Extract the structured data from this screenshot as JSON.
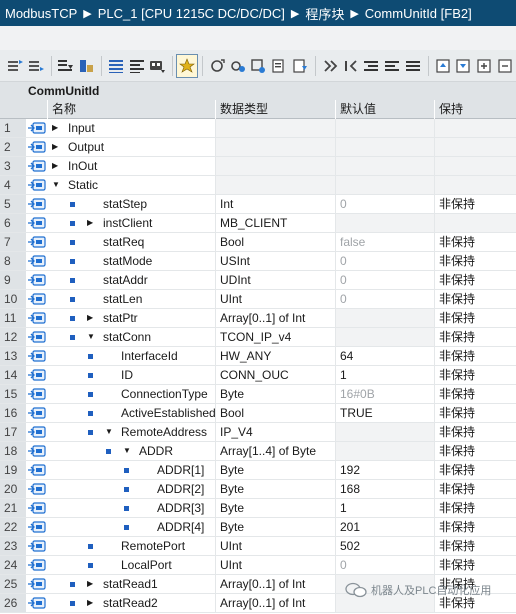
{
  "breadcrumb": [
    "ModbusTCP",
    "PLC_1 [CPU 1215C DC/DC/DC]",
    "程序块",
    "CommUnitId [FB2]"
  ],
  "block_name": "CommUnitId",
  "columns": {
    "name": "名称",
    "type": "数据类型",
    "default": "默认值",
    "retain": "保持"
  },
  "toolbar_icons": [
    "insert-row-icon",
    "add-row-icon",
    "expand-icon",
    "collapse-icon",
    "monitor-icon",
    "list-icon",
    "list-alt-icon",
    "snapshot-icon",
    "load-icon",
    "highlight-icon",
    "reset-icon",
    "go-icon",
    "watch-icon",
    "copy-values-icon",
    "paste-values-icon",
    "indent-icon",
    "outdent-icon",
    "align-icon",
    "move-up-icon",
    "move-down-icon",
    "expand-all-icon",
    "collapse-all-icon"
  ],
  "rows": [
    {
      "num": "1",
      "name": "Input",
      "type": "",
      "default": "",
      "retain": "",
      "depth": 0,
      "arrow": "right",
      "bullet": false,
      "default_gray": false
    },
    {
      "num": "2",
      "name": "Output",
      "type": "",
      "default": "",
      "retain": "",
      "depth": 0,
      "arrow": "right",
      "bullet": false,
      "default_gray": false
    },
    {
      "num": "3",
      "name": "InOut",
      "type": "",
      "default": "",
      "retain": "",
      "depth": 0,
      "arrow": "right",
      "bullet": false,
      "default_gray": false
    },
    {
      "num": "4",
      "name": "Static",
      "type": "",
      "default": "",
      "retain": "",
      "depth": 0,
      "arrow": "down",
      "bullet": false,
      "default_gray": false
    },
    {
      "num": "5",
      "name": "statStep",
      "type": "Int",
      "default": "0",
      "retain": "非保持",
      "depth": 1,
      "arrow": "",
      "bullet": true,
      "default_gray": true
    },
    {
      "num": "6",
      "name": "instClient",
      "type": "MB_CLIENT",
      "default": "",
      "retain": "",
      "depth": 1,
      "arrow": "right",
      "bullet": true,
      "default_gray": false
    },
    {
      "num": "7",
      "name": "statReq",
      "type": "Bool",
      "default": "false",
      "retain": "非保持",
      "depth": 1,
      "arrow": "",
      "bullet": true,
      "default_gray": true
    },
    {
      "num": "8",
      "name": "statMode",
      "type": "USInt",
      "default": "0",
      "retain": "非保持",
      "depth": 1,
      "arrow": "",
      "bullet": true,
      "default_gray": true
    },
    {
      "num": "9",
      "name": "statAddr",
      "type": "UDInt",
      "default": "0",
      "retain": "非保持",
      "depth": 1,
      "arrow": "",
      "bullet": true,
      "default_gray": true
    },
    {
      "num": "10",
      "name": "statLen",
      "type": "UInt",
      "default": "0",
      "retain": "非保持",
      "depth": 1,
      "arrow": "",
      "bullet": true,
      "default_gray": true
    },
    {
      "num": "11",
      "name": "statPtr",
      "type": "Array[0..1] of Int",
      "default": "",
      "retain": "非保持",
      "depth": 1,
      "arrow": "right",
      "bullet": true,
      "default_gray": false
    },
    {
      "num": "12",
      "name": "statConn",
      "type": "TCON_IP_v4",
      "default": "",
      "retain": "非保持",
      "depth": 1,
      "arrow": "down",
      "bullet": true,
      "default_gray": false
    },
    {
      "num": "13",
      "name": "InterfaceId",
      "type": "HW_ANY",
      "default": "64",
      "retain": "非保持",
      "depth": 2,
      "arrow": "",
      "bullet": true,
      "default_gray": false
    },
    {
      "num": "14",
      "name": "ID",
      "type": "CONN_OUC",
      "default": "1",
      "retain": "非保持",
      "depth": 2,
      "arrow": "",
      "bullet": true,
      "default_gray": false
    },
    {
      "num": "15",
      "name": "ConnectionType",
      "type": "Byte",
      "default": "16#0B",
      "retain": "非保持",
      "depth": 2,
      "arrow": "",
      "bullet": true,
      "default_gray": true
    },
    {
      "num": "16",
      "name": "ActiveEstablished",
      "type": "Bool",
      "default": "TRUE",
      "retain": "非保持",
      "depth": 2,
      "arrow": "",
      "bullet": true,
      "default_gray": false
    },
    {
      "num": "17",
      "name": "RemoteAddress",
      "type": "IP_V4",
      "default": "",
      "retain": "非保持",
      "depth": 2,
      "arrow": "down",
      "bullet": true,
      "default_gray": false
    },
    {
      "num": "18",
      "name": "ADDR",
      "type": "Array[1..4] of Byte",
      "default": "",
      "retain": "非保持",
      "depth": 3,
      "arrow": "down",
      "bullet": true,
      "default_gray": false
    },
    {
      "num": "19",
      "name": "ADDR[1]",
      "type": "Byte",
      "default": "192",
      "retain": "非保持",
      "depth": 4,
      "arrow": "",
      "bullet": true,
      "default_gray": false
    },
    {
      "num": "20",
      "name": "ADDR[2]",
      "type": "Byte",
      "default": "168",
      "retain": "非保持",
      "depth": 4,
      "arrow": "",
      "bullet": true,
      "default_gray": false
    },
    {
      "num": "21",
      "name": "ADDR[3]",
      "type": "Byte",
      "default": "1",
      "retain": "非保持",
      "depth": 4,
      "arrow": "",
      "bullet": true,
      "default_gray": false
    },
    {
      "num": "22",
      "name": "ADDR[4]",
      "type": "Byte",
      "default": "201",
      "retain": "非保持",
      "depth": 4,
      "arrow": "",
      "bullet": true,
      "default_gray": false
    },
    {
      "num": "23",
      "name": "RemotePort",
      "type": "UInt",
      "default": "502",
      "retain": "非保持",
      "depth": 2,
      "arrow": "",
      "bullet": true,
      "default_gray": false
    },
    {
      "num": "24",
      "name": "LocalPort",
      "type": "UInt",
      "default": "0",
      "retain": "非保持",
      "depth": 2,
      "arrow": "",
      "bullet": true,
      "default_gray": true
    },
    {
      "num": "25",
      "name": "statRead1",
      "type": "Array[0..1] of Int",
      "default": "",
      "retain": "非保持",
      "depth": 1,
      "arrow": "right",
      "bullet": true,
      "default_gray": false
    },
    {
      "num": "26",
      "name": "statRead2",
      "type": "Array[0..1] of Int",
      "default": "",
      "retain": "非保持",
      "depth": 1,
      "arrow": "right",
      "bullet": true,
      "default_gray": false
    }
  ],
  "watermark": "机器人及PLC自动化应用",
  "colors": {
    "titlebar": "#0e4b73",
    "header": "#dfe3e6",
    "bullet": "#1f5fbf",
    "iface_icon": "#1f6fd1"
  }
}
